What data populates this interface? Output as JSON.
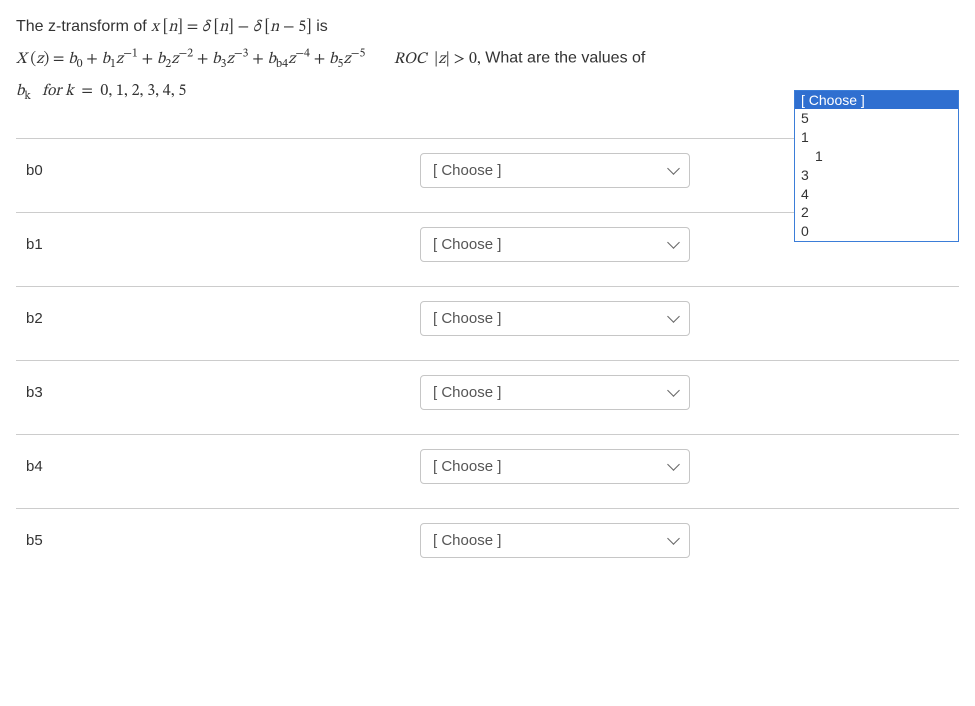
{
  "question": {
    "line1_prefix": "The z-transform of ",
    "line1_math": "x [n] = δ [n] − δ [n − 5]",
    "line1_suffix": "is",
    "line2_math": "X (z) = b₀ + b₁z⁻¹ + b₂z⁻² + b₃z⁻³ + b_{b4}z⁻⁴ + b₅z⁻⁵",
    "line2_roc": "ROC |z| > 0,",
    "line2_suffix": " What are the values of",
    "line3_math": "b_k  for k  =  0, 1, 2, 3, 4, 5"
  },
  "dropdown": {
    "header": "[ Choose ]",
    "options": [
      "5",
      "1",
      "1",
      "3",
      "4",
      "2",
      "0"
    ]
  },
  "rows": [
    {
      "label": "b0",
      "placeholder": "[ Choose ]"
    },
    {
      "label": "b1",
      "placeholder": "[ Choose ]"
    },
    {
      "label": "b2",
      "placeholder": "[ Choose ]"
    },
    {
      "label": "b3",
      "placeholder": "[ Choose ]"
    },
    {
      "label": "b4",
      "placeholder": "[ Choose ]"
    },
    {
      "label": "b5",
      "placeholder": "[ Choose ]"
    }
  ]
}
